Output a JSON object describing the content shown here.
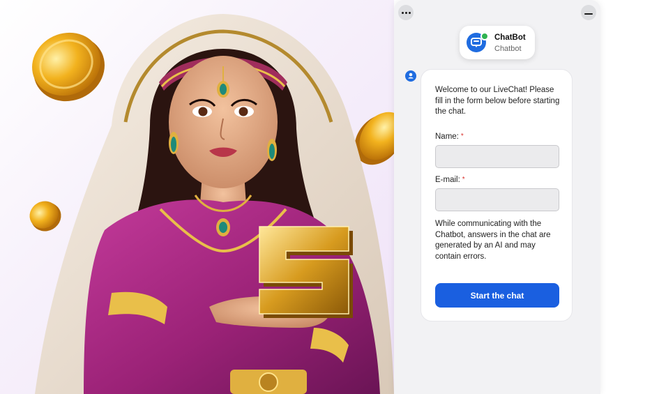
{
  "promo": {
    "banner_glyph": "5",
    "subject": "illustrated woman in magenta dress holding a gold 5 emblem with floating gold coins"
  },
  "chat": {
    "menu_icon": "more-horizontal-icon",
    "minimize_icon": "minimize-icon",
    "bot": {
      "name": "ChatBot",
      "subtitle": "Chatbot",
      "status": "online",
      "avatar_icon": "chat-bubble-icon",
      "accent_color": "#1f6ce0",
      "status_color": "#2fb350"
    },
    "message_avatar_icon": "user-icon",
    "form": {
      "welcome": "Welcome to our LiveChat! Please fill in the form below before starting the chat.",
      "name_label": "Name:",
      "name_value": "",
      "email_label": "E-mail:",
      "email_value": "",
      "required_mark": "*",
      "disclaimer": "While communicating with the Chatbot, answers in the chat are generated by an AI and may contain errors.",
      "submit_label": "Start the chat",
      "submit_color": "#1a5fe0",
      "required_color": "#d9302b"
    }
  }
}
